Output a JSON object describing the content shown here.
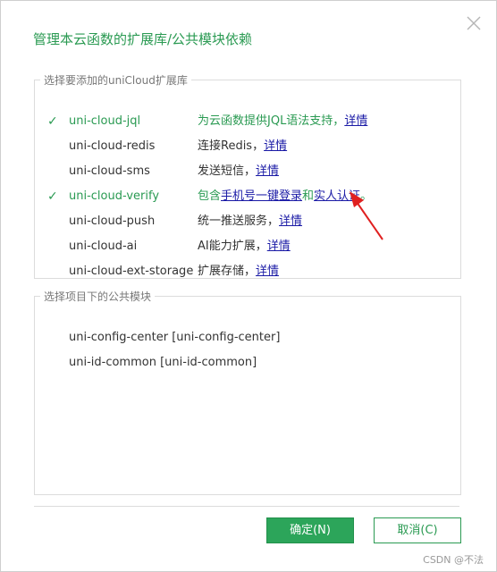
{
  "dialog": {
    "title": "管理本云函数的扩展库/公共模块依赖",
    "close_icon": "close-icon"
  },
  "extensions": {
    "legend": "选择要添加的uniCloud扩展库",
    "items": [
      {
        "name": "uni-cloud-jql",
        "checked": true,
        "desc": "为云函数提供JQL语法支持，",
        "link": "详情"
      },
      {
        "name": "uni-cloud-redis",
        "checked": false,
        "desc": "连接Redis，",
        "link": "详情"
      },
      {
        "name": "uni-cloud-sms",
        "checked": false,
        "desc": "发送短信，",
        "link": "详情"
      },
      {
        "name": "uni-cloud-verify",
        "checked": true,
        "desc_prefix": "包含",
        "link1": "手机号一键登录",
        "desc_mid": "和",
        "link2": "实人认证",
        "desc_suffix": "。"
      },
      {
        "name": "uni-cloud-push",
        "checked": false,
        "desc": "统一推送服务，",
        "link": "详情"
      },
      {
        "name": "uni-cloud-ai",
        "checked": false,
        "desc": "AI能力扩展，",
        "link": "详情"
      },
      {
        "name": "uni-cloud-ext-storage",
        "checked": false,
        "desc": "扩展存储，",
        "link": "详情"
      }
    ]
  },
  "modules": {
    "legend": "选择项目下的公共模块",
    "items": [
      "uni-config-center [uni-config-center]",
      "uni-id-common [uni-id-common]"
    ]
  },
  "buttons": {
    "ok": "确定(N)",
    "cancel": "取消(C)"
  },
  "watermark": "CSDN @不法",
  "colors": {
    "accent": "#2a9a52",
    "link": "#1a1aa6",
    "annotation_arrow": "#e02020"
  }
}
